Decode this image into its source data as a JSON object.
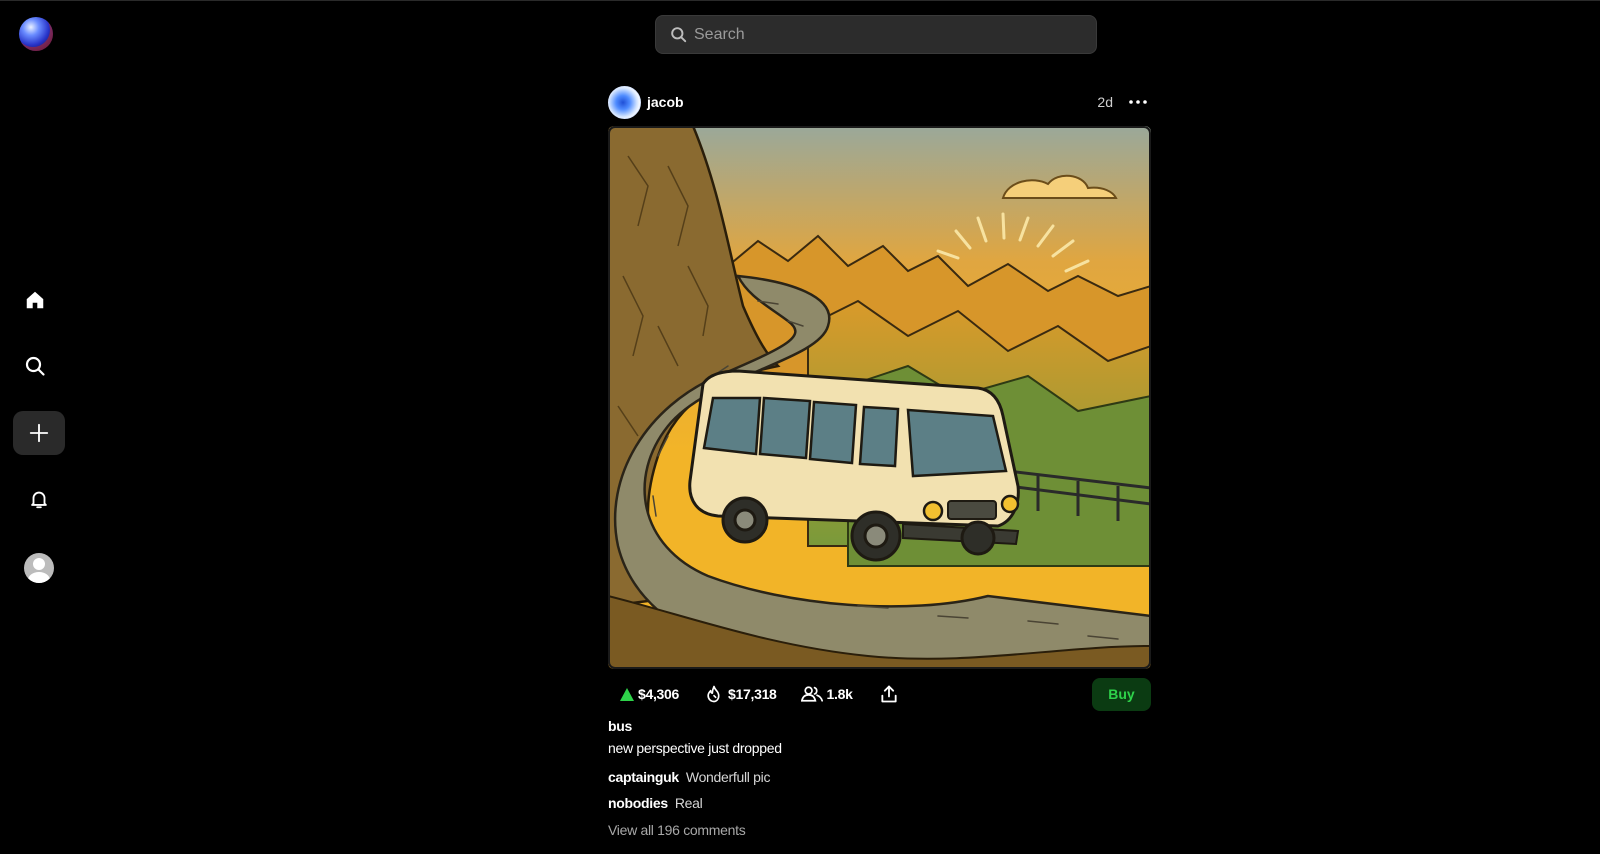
{
  "search": {
    "placeholder": "Search"
  },
  "post": {
    "username": "jacob",
    "time": "2d",
    "stats": {
      "upvote_value": "$4,306",
      "fire_value": "$17,318",
      "holders": "1.8k"
    },
    "buy_label": "Buy",
    "title": "bus",
    "description": "new perspective just dropped",
    "comments": [
      {
        "user": "captainguk",
        "text": "Wonderfull pic"
      },
      {
        "user": "nobodies",
        "text": "Real"
      }
    ],
    "view_all_label": "View all 196 comments"
  },
  "colors": {
    "background": "#000000",
    "accent_green": "#2ed34a",
    "buy_bg": "#0b3b12",
    "search_bg": "#2c2c2c"
  },
  "icons": [
    "app-logo-icon",
    "home-icon",
    "search-icon",
    "plus-icon",
    "bell-icon",
    "profile-icon",
    "more-icon",
    "upvote-icon",
    "fire-icon",
    "people-icon",
    "share-icon"
  ]
}
